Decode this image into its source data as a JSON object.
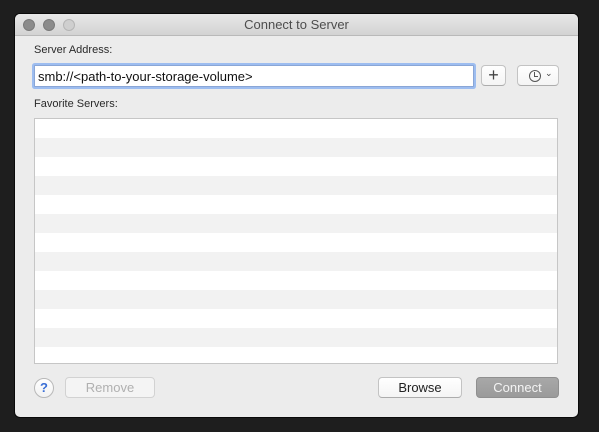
{
  "window": {
    "title": "Connect to Server"
  },
  "form": {
    "server_address_label": "Server Address:",
    "server_address_value": "smb://<path-to-your-storage-volume>",
    "favorites_label": "Favorite Servers:",
    "favorites": []
  },
  "buttons": {
    "add_favorite": "+",
    "recent_servers_icon": "clock-icon",
    "help": "?",
    "remove": "Remove",
    "browse": "Browse",
    "connect": "Connect"
  },
  "colors": {
    "focus_ring": "#9dbdf0",
    "help_blue": "#3b6fd6",
    "connect_disabled": "#9a9a9a"
  }
}
